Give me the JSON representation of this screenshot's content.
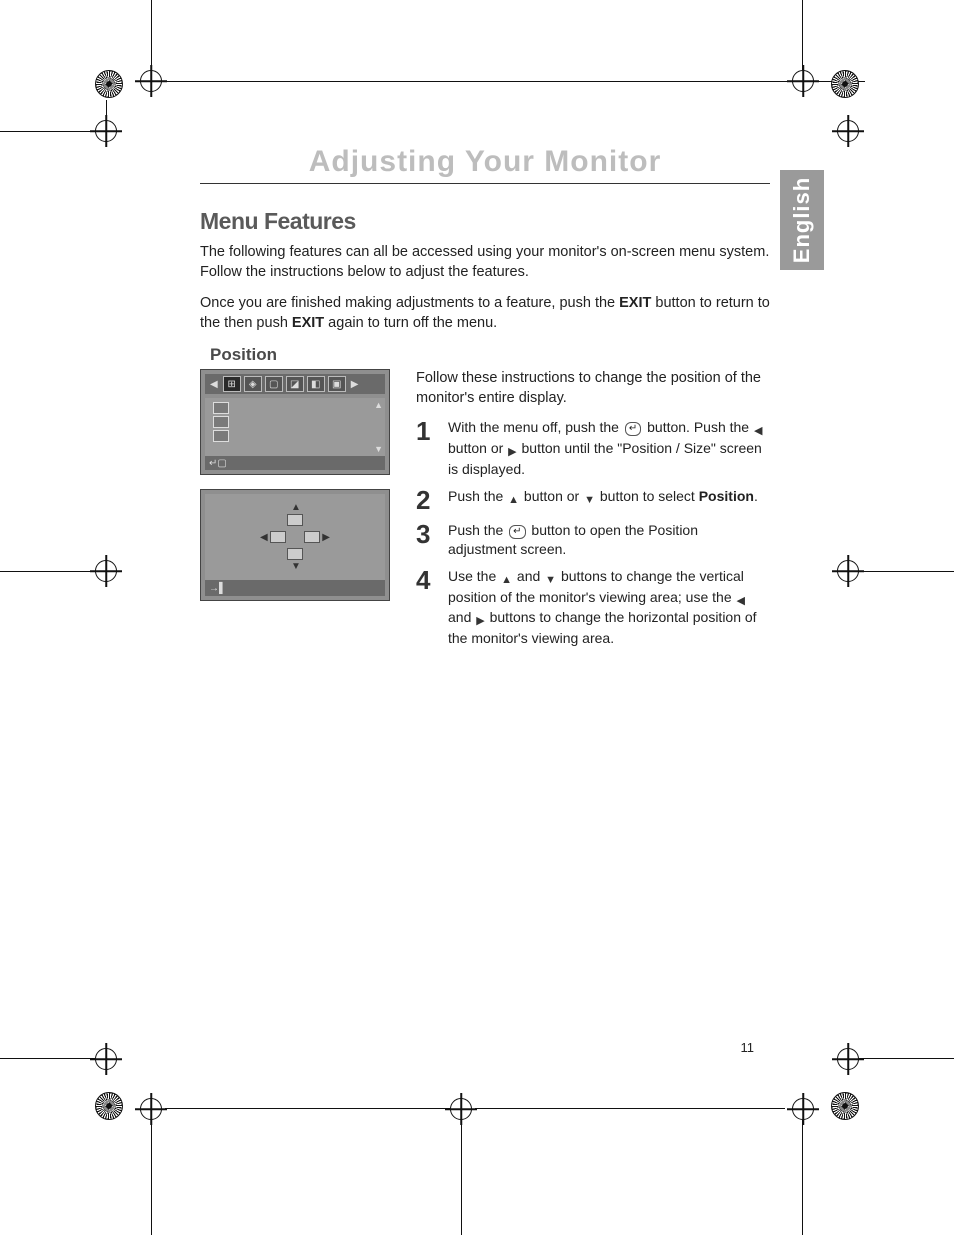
{
  "page": {
    "title": "Adjusting Your Monitor",
    "language_tab": "English",
    "page_number": "11"
  },
  "section": {
    "heading": "Menu Features",
    "para1": "The following features can all be accessed using your monitor's on-screen menu system. Follow the instructions below to adjust the features.",
    "para2_a": "Once you are finished making adjustments to a feature, push the ",
    "para2_b": "EXIT",
    "para2_c": " button to return to the then push ",
    "para2_d": "EXIT",
    "para2_e": " again to turn off the menu."
  },
  "position": {
    "subheading": "Position",
    "intro": "Follow these instructions to change the position of the monitor's entire display.",
    "steps": [
      {
        "num": "1",
        "a": "With the menu off, push the ",
        "b": " button. Push the ",
        "c": " button or ",
        "d": " button until the \"Position / Size\" screen is displayed."
      },
      {
        "num": "2",
        "a": "Push the ",
        "b": " button or ",
        "c": " button to select ",
        "bold": "Position",
        "d": "."
      },
      {
        "num": "3",
        "a": "Push the ",
        "b": " button to open the Position adjustment screen."
      },
      {
        "num": "4",
        "a": "Use the ",
        "b": " and ",
        "c": " buttons to change the vertical position of the monitor's viewing area; use the ",
        "d": " and ",
        "e": " buttons to change the horizontal position of the monitor's viewing area."
      }
    ]
  }
}
